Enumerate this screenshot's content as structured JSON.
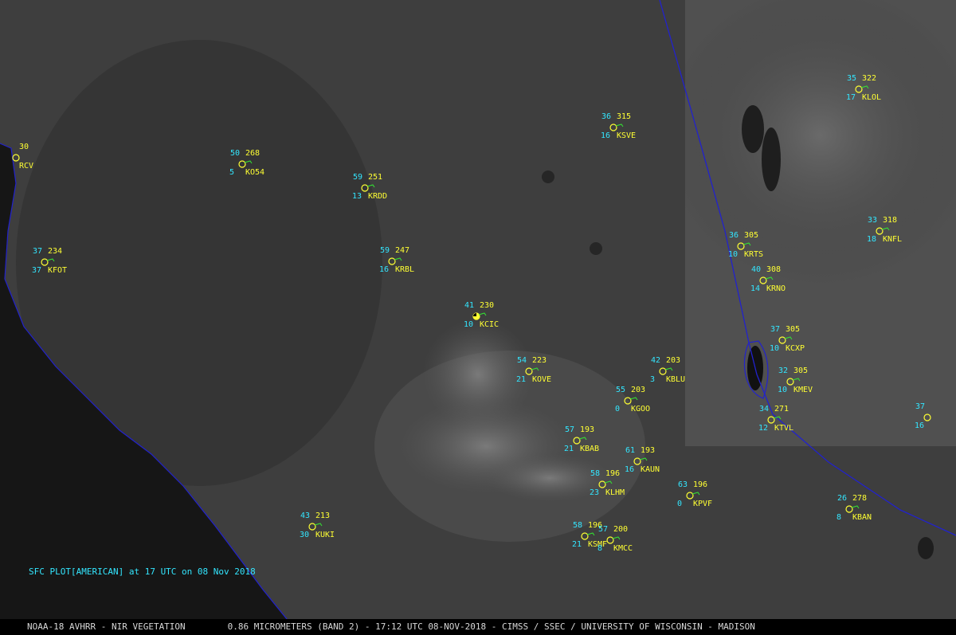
{
  "plot_title": "SFC PLOT[AMERICAN] at 17 UTC on 08 Nov 2018",
  "footer": "NOAA-18 AVHRR - NIR VEGETATION        0.86 MICROMETERS (BAND 2) - 17:12 UTC 08-NOV-2018 - CIMSS / SSEC / UNIVERSITY OF WISCONSIN - MADISON",
  "colors": {
    "temperature": "#33e6ff",
    "pressure": "#ffff33",
    "station_id": "#ffff33",
    "visibility": "#33e6ff",
    "wind_barb": "#33e633",
    "border": "#2222cc"
  },
  "stations": [
    {
      "id": "ACV",
      "temp": "",
      "pres": "30",
      "vis": "",
      "id_label": "RCV",
      "partial": true
    },
    {
      "id": "KO54",
      "temp": "50",
      "pres": "268",
      "vis": "5",
      "id_label": "KO54"
    },
    {
      "id": "KRDD",
      "temp": "59",
      "pres": "251",
      "vis": "13",
      "id_label": "KRDD"
    },
    {
      "id": "KFOT",
      "temp": "37",
      "pres": "234",
      "vis": "37",
      "id_label": "KFOT"
    },
    {
      "id": "KRBL",
      "temp": "59",
      "pres": "247",
      "vis": "16",
      "id_label": "KRBL"
    },
    {
      "id": "KCIC",
      "temp": "41",
      "pres": "230",
      "vis": "10",
      "id_label": "KCIC",
      "cloud": "broken"
    },
    {
      "id": "KOVE",
      "temp": "54",
      "pres": "223",
      "vis": "21",
      "id_label": "KOVE"
    },
    {
      "id": "KBLU",
      "temp": "42",
      "pres": "203",
      "vis": "3",
      "id_label": "KBLU"
    },
    {
      "id": "KGOO",
      "temp": "55",
      "pres": "203",
      "vis": "0",
      "id_label": "KGOO"
    },
    {
      "id": "KBAB",
      "temp": "57",
      "pres": "193",
      "vis": "21",
      "id_label": "KBAB"
    },
    {
      "id": "KAUN",
      "temp": "61",
      "pres": "193",
      "vis": "16",
      "id_label": "KAUN"
    },
    {
      "id": "KLHM",
      "temp": "58",
      "pres": "196",
      "vis": "23",
      "id_label": "KLHM"
    },
    {
      "id": "KPVF",
      "temp": "63",
      "pres": "196",
      "vis": "0",
      "id_label": "KPVF"
    },
    {
      "id": "KUKI",
      "temp": "43",
      "pres": "213",
      "vis": "30",
      "id_label": "KUKI"
    },
    {
      "id": "KSMF",
      "temp": "58",
      "pres": "196",
      "vis": "21",
      "id_label": "KSMF"
    },
    {
      "id": "KMCC",
      "temp": "57",
      "pres": "200",
      "vis": "8",
      "id_label": "KMCC"
    },
    {
      "id": "KSVE",
      "temp": "36",
      "pres": "315",
      "vis": "16",
      "id_label": "KSVE"
    },
    {
      "id": "KRTS",
      "temp": "36",
      "pres": "305",
      "vis": "10",
      "id_label": "KRTS"
    },
    {
      "id": "KRNO",
      "temp": "40",
      "pres": "308",
      "vis": "14",
      "id_label": "KRNO"
    },
    {
      "id": "KCXP",
      "temp": "37",
      "pres": "305",
      "vis": "10",
      "id_label": "KCXP"
    },
    {
      "id": "KMEV",
      "temp": "32",
      "pres": "305",
      "vis": "10",
      "id_label": "KMEV"
    },
    {
      "id": "KTVL",
      "temp": "34",
      "pres": "271",
      "vis": "12",
      "id_label": "KTVL"
    },
    {
      "id": "KBAN",
      "temp": "26",
      "pres": "278",
      "vis": "8",
      "id_label": "KBAN"
    },
    {
      "id": "KLOL",
      "temp": "35",
      "pres": "322",
      "vis": "17",
      "id_label": "KLOL"
    },
    {
      "id": "KNFL",
      "temp": "33",
      "pres": "318",
      "vis": "18",
      "id_label": "KNFL"
    },
    {
      "id": "EDGE",
      "temp": "37",
      "pres": "",
      "vis": "16",
      "id_label": "",
      "partial": true
    }
  ]
}
